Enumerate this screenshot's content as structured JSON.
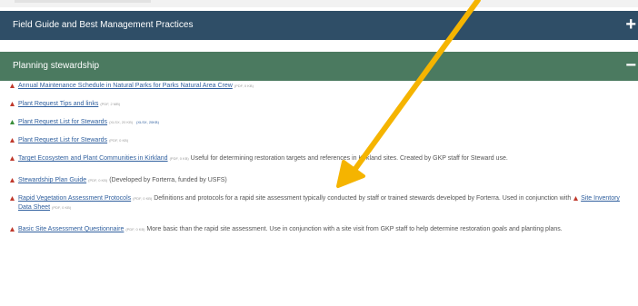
{
  "accordion": {
    "section1_title": "Field Guide and Best Management Practices",
    "section1_sign": "+",
    "section2_title": "Planning stewardship",
    "section2_sign": "−"
  },
  "items": [
    {
      "link": "Annual Maintenance Schedule in Natural Parks for Parks Natural Area Crew",
      "size": "(PDF, 0 KB)",
      "desc": ""
    },
    {
      "link": "Plant Request Tips and links",
      "size": "(PDF, 2 MB)",
      "desc": ""
    },
    {
      "link": "Plant Request List for Stewards",
      "size": "(XLSX, 20 KB)",
      "link2": "(XLSX, 20KB)",
      "desc": ""
    },
    {
      "link": "Plant Request List for Stewards",
      "size": "(PDF, 0 KB)",
      "desc": ""
    },
    {
      "link": "Target Ecosystem and Plant Communities in Kirkland",
      "size": "(PDF, 0 KB)",
      "desc": "Useful for determining restoration targets and references in Kirkland sites. Created by GKP staff for Steward use."
    },
    {
      "link": "Stewardship Plan Guide",
      "size": "(PDF, 0 KB)",
      "desc": "(Developed by Forterra, funded by USFS)"
    },
    {
      "link": "Rapid Vegetation Assessment Protocols",
      "size": "(PDF, 0 KB)",
      "desc": "Definitions and protocols for a rapid site assessment typically conducted by staff or trained stewards developed by Forterra. Used in conjunction with",
      "link3": "Site Inventory Data Sheet",
      "size3": "(PDF, 0 KB)"
    },
    {
      "link": "Basic Site Assessment Questionnaire",
      "size": "(PDF, 0 KB)",
      "desc": "More basic than the rapid site assessment. Use in conjunction with a site visit from GKP staff to help determine restoration goals and planting plans."
    }
  ],
  "colors": {
    "accordion_blue": "#2f4e67",
    "accordion_green": "#4b7a60",
    "link": "#2f5f9e",
    "arrow": "#f5b400",
    "pdf_icon": "#c0392b",
    "xlsx_icon": "#3a8f3a"
  }
}
